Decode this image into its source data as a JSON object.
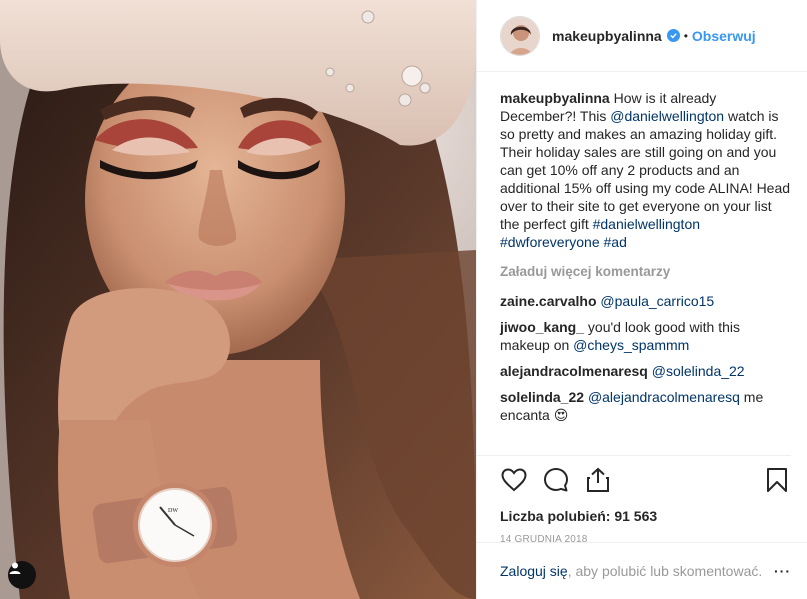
{
  "post": {
    "username": "makeupbyalinna",
    "follow_label": "Obserwuj",
    "dot": "•",
    "caption": {
      "username": "makeupbyalinna",
      "text_1": " How is it already December?! This ",
      "mention_1": "@danielwellington",
      "text_2": " watch is so pretty and makes an amazing holiday gift. Their holiday sales are still going on and you can get 10% off any 2 products and an additional 15% off using my code ALINA! Head over to their site to get everyone on your list the perfect gift ",
      "hashtag_1": "#danielwellington",
      "space": " ",
      "hashtag_2": "#dwforeveryone",
      "hashtag_3": "#ad"
    },
    "load_more_label": "Załaduj więcej komentarzy",
    "comments": [
      {
        "username": "zaine.carvalho",
        "mention": "@paula_carrico15",
        "text": ""
      },
      {
        "username": "jiwoo_kang_",
        "text_before": " you'd look good with this makeup on ",
        "mention": "@cheys_spammm"
      },
      {
        "username": "alejandracolmenaresq",
        "mention": "@solelinda_22"
      },
      {
        "username": "solelinda_22",
        "mention": "@alejandracolmenaresq",
        "text_after": " me encanta ",
        "emoji": "😍"
      }
    ],
    "likes_label": "Liczba polubień: 91 563",
    "date": "14 grudnia 2018",
    "login": {
      "link": "Zaloguj się",
      "text": ", aby polubić lub skomentować.",
      "more": "···"
    },
    "icons": {
      "like": "heart-icon",
      "comment": "comment-icon",
      "share": "share-icon",
      "save": "bookmark-icon",
      "verified": "verified-badge-icon",
      "tag": "user-tag-icon"
    },
    "colors": {
      "accent": "#3897f0",
      "link": "#003569",
      "muted": "#999999",
      "text": "#262626"
    }
  }
}
